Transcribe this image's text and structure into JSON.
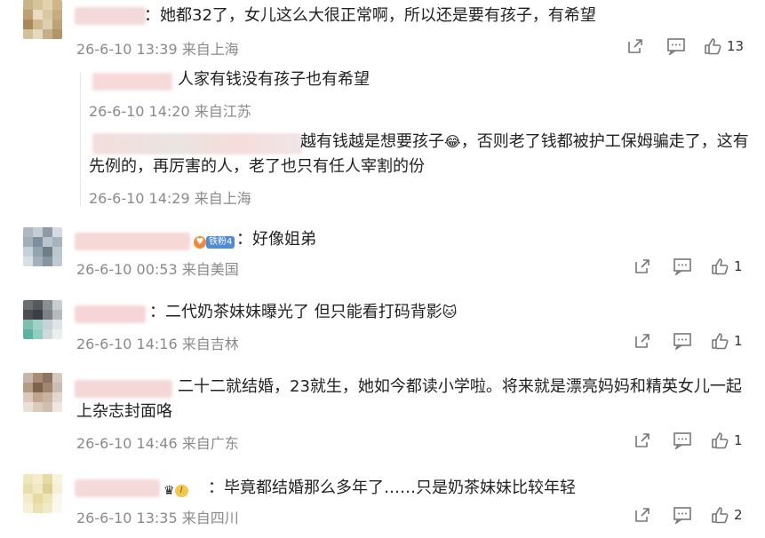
{
  "comments": [
    {
      "text": "：她都32了，女儿这么大很正常啊，所以还是要有孩子，有希望",
      "meta": "26-6-10 13:39 来自上海",
      "likes": "13"
    },
    {
      "reply1_text": "人家有钱没有孩子也有希望",
      "reply1_meta": "26-6-10 14:20 来自江苏",
      "reply2_text_line1": "越有钱越是想要孩子",
      "reply2_text_line1b": "，否则老了钱都被护工保姆骗走了，这有",
      "reply2_text_line2": "先例的，再厉害的人，老了也只有任人宰割的份",
      "reply2_meta": "26-6-10 14:29 来自上海"
    },
    {
      "badge": "铁粉4",
      "text": "：好像姐弟",
      "meta": "26-6-10 00:53 来自美国",
      "likes": "1"
    },
    {
      "text": "：二代奶茶妹妹曝光了 但只能看打码背影",
      "meta": "26-6-10 14:16 来自吉林",
      "likes": "1"
    },
    {
      "text_line1": "二十二就结婚，23就生，她如今都读小学啦。将来就是漂亮妈妈和精英女儿一起",
      "text_line2": "上杂志封面咯",
      "meta": "26-6-10 14:46 来自广东",
      "likes": "1"
    },
    {
      "level": "I",
      "text": "：毕竟都结婚那么多年了……只是奶茶妹妹比较年轻",
      "meta": "26-6-10 13:35 来自四川",
      "likes": "2"
    }
  ],
  "icons": {
    "share": "share-icon",
    "comment": "comment-icon",
    "like": "thumbs-up-icon",
    "emoji_cry_laugh": "😂",
    "emoji_cat": "🐱"
  }
}
